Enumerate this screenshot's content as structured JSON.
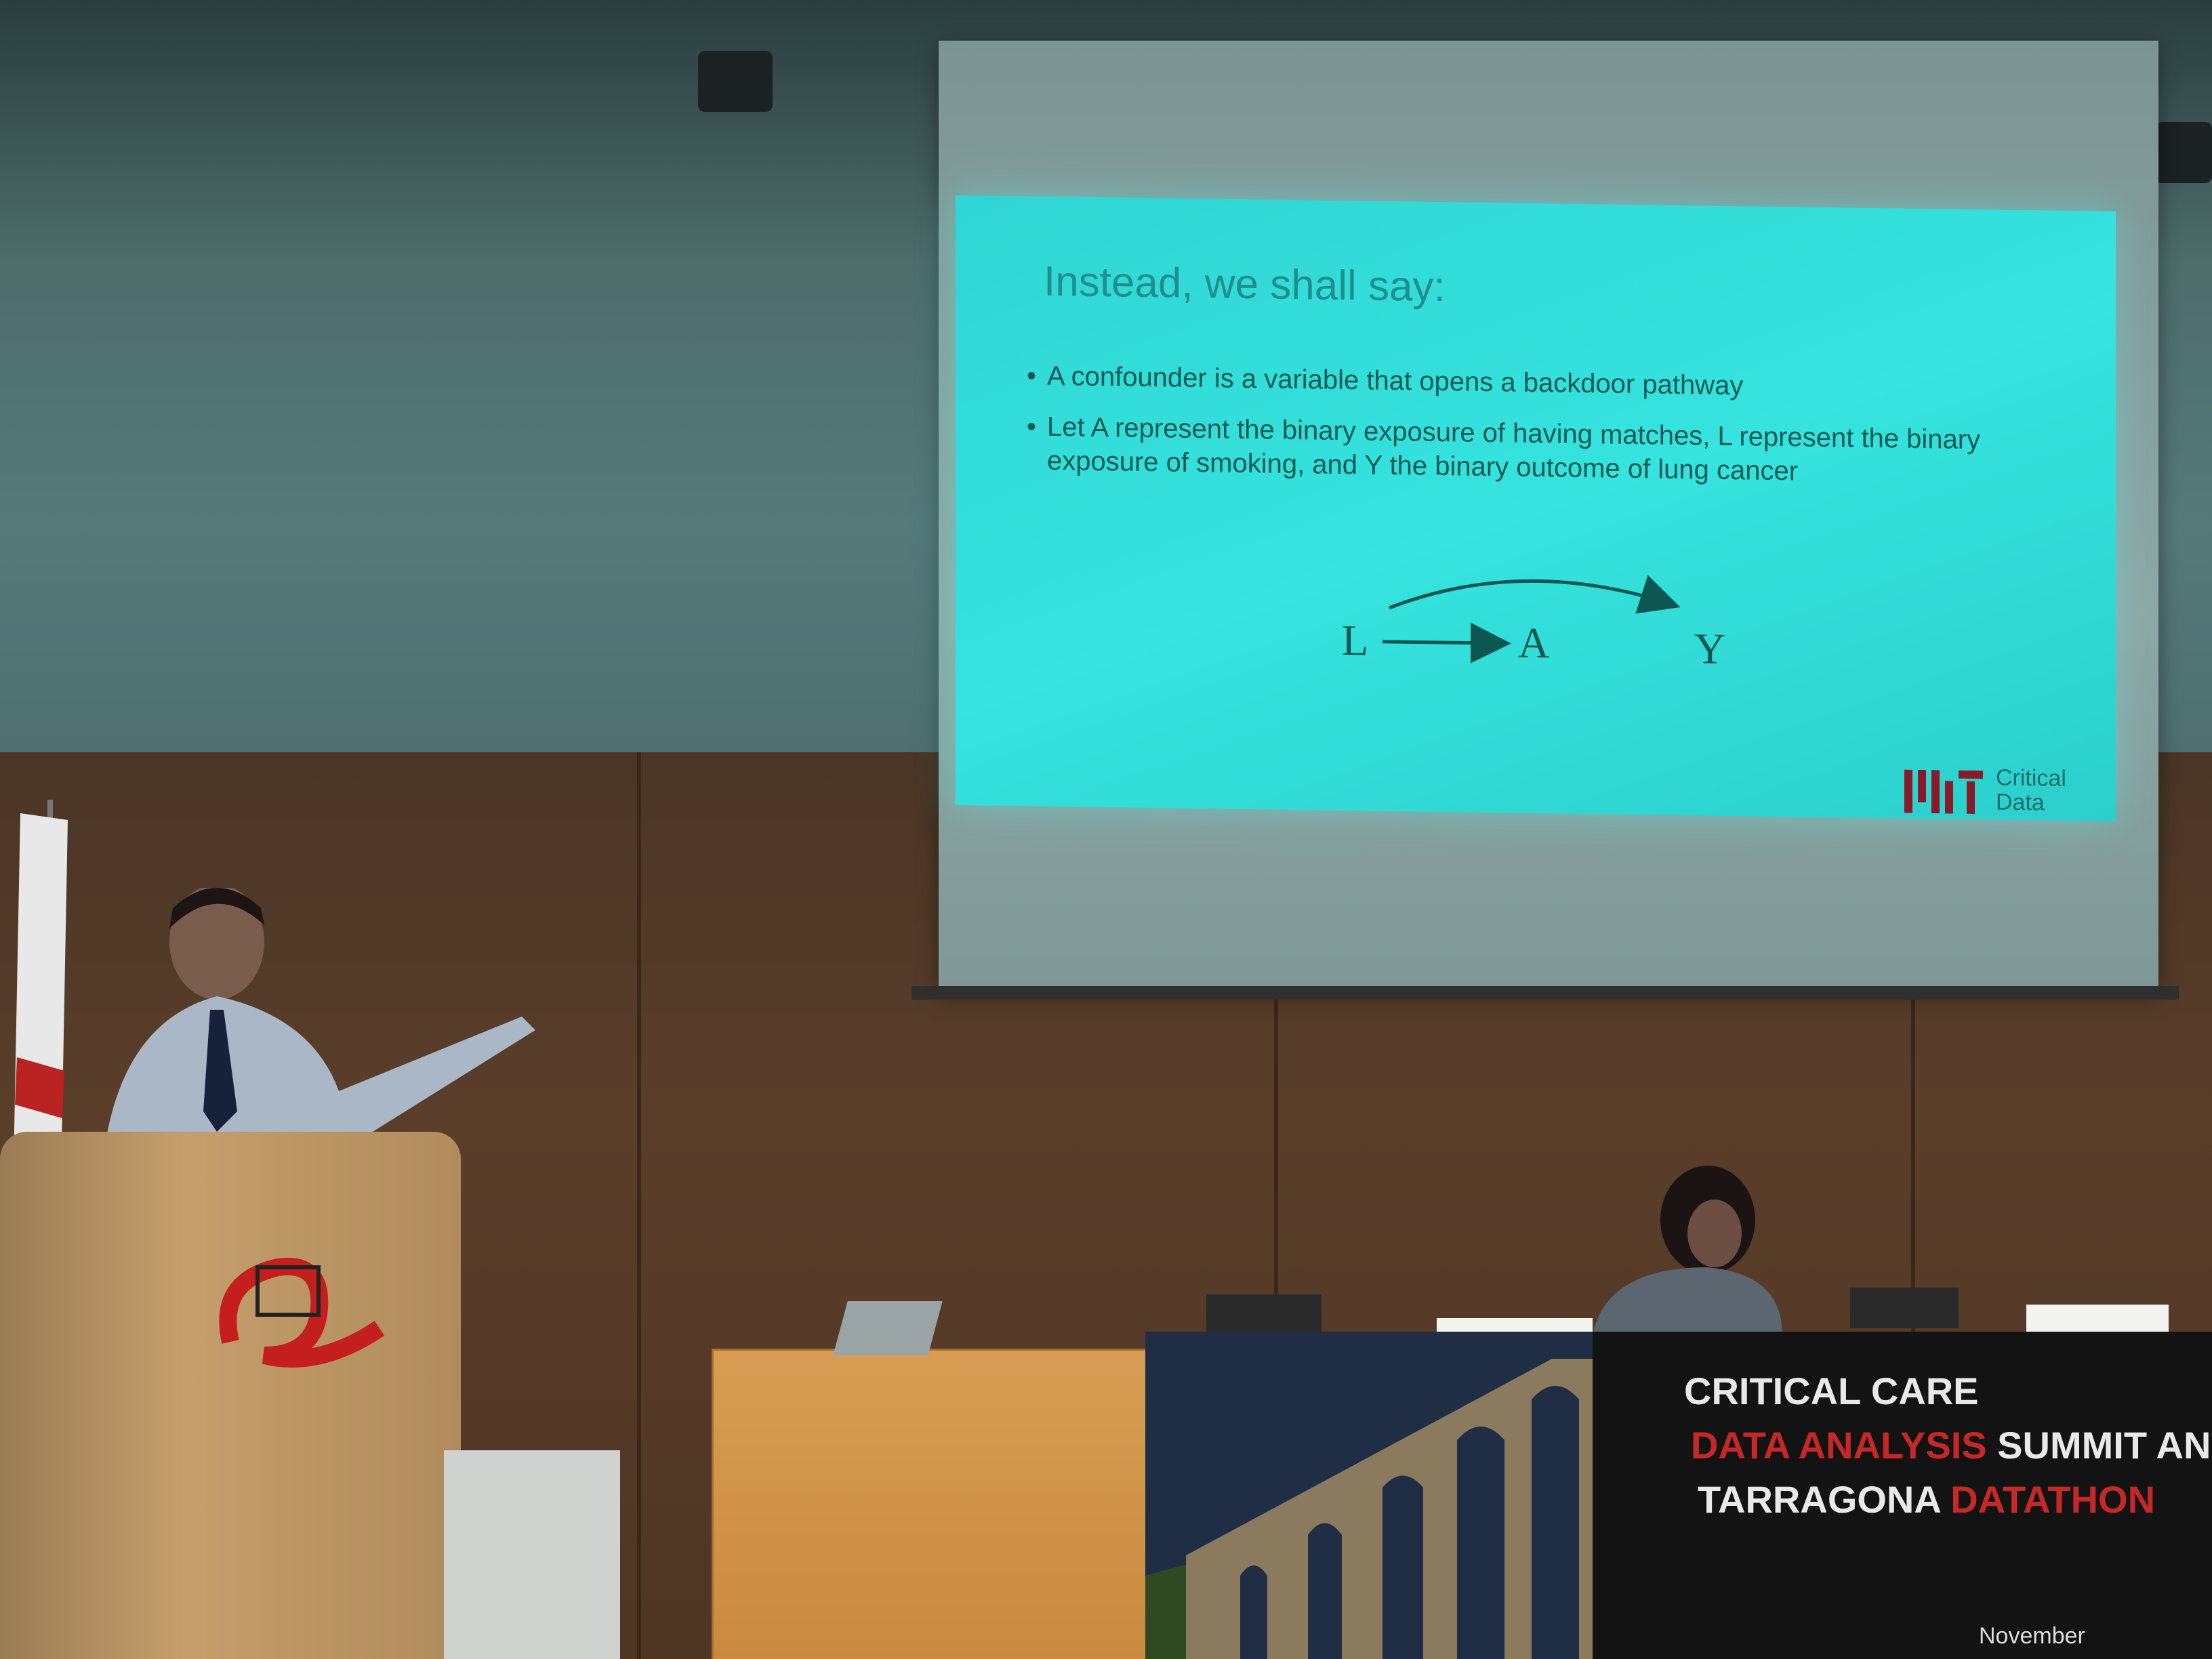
{
  "slide": {
    "title": "Instead, we shall say:",
    "bullets": [
      "A confounder is a variable that opens a backdoor pathway",
      "Let A represent the binary exposure of having matches, L represent the binary exposure of smoking, and Y the binary outcome of lung cancer"
    ],
    "diagram": {
      "nodes": [
        "L",
        "A",
        "Y"
      ]
    },
    "logo_text_line1": "Critical",
    "logo_text_line2": "Data"
  },
  "banner": {
    "line1": "CRITICAL CARE",
    "line2_accent": "DATA ANALYSIS",
    "line2_rest": " SUMMIT AND",
    "line3_rest": "TARRAGONA ",
    "line3_accent": "DATATHON",
    "date": "November"
  },
  "colors": {
    "slide_bg": "#34dfda",
    "slide_text": "#0e5a56",
    "banner_bg": "#141313",
    "banner_accent": "#c62828",
    "wood": "#5a3e2a"
  }
}
